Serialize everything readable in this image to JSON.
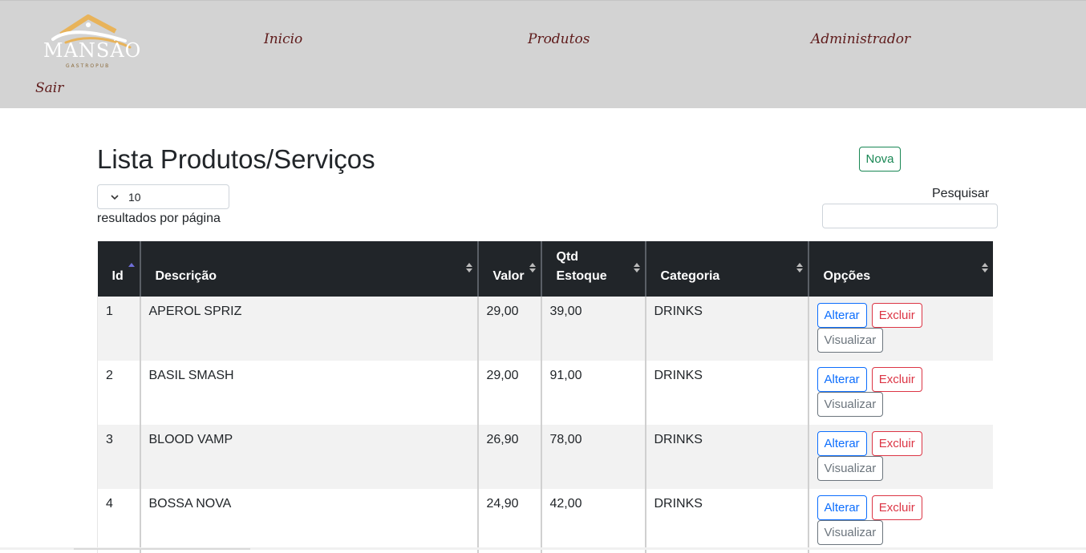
{
  "brand": {
    "logo_text": "MANSÃO",
    "logo_subtext": "GASTROPUB"
  },
  "nav": {
    "inicio": "Inicio",
    "produtos": "Produtos",
    "administrador": "Administrador",
    "sair": "Sair"
  },
  "page": {
    "title": "Lista Produtos/Serviços",
    "new_button": "Nova",
    "per_page_value": "10",
    "per_page_label": "resultados por página",
    "search_label": "Pesquisar",
    "search_value": ""
  },
  "table": {
    "columns": [
      "Id",
      "Descrição",
      "Valor",
      "Qtd Estoque",
      "Categoria",
      "Opções"
    ],
    "sorted_column": "Id",
    "sort_direction": "ascending",
    "rows": [
      {
        "id": "1",
        "descricao": "APEROL SPRIZ",
        "valor": "29,00",
        "qtd": "39,00",
        "categoria": "DRINKS"
      },
      {
        "id": "2",
        "descricao": "BASIL SMASH",
        "valor": "29,00",
        "qtd": "91,00",
        "categoria": "DRINKS"
      },
      {
        "id": "3",
        "descricao": "BLOOD VAMP",
        "valor": "26,90",
        "qtd": "78,00",
        "categoria": "DRINKS"
      },
      {
        "id": "4",
        "descricao": "BOSSA NOVA",
        "valor": "24,90",
        "qtd": "42,00",
        "categoria": "DRINKS"
      }
    ],
    "actions": {
      "edit": "Alterar",
      "delete": "Excluir",
      "view": "Visualizar"
    }
  },
  "colors": {
    "header_bg": "#d3d3d3",
    "nav_text": "#5e1a1a",
    "table_head_bg": "#212529",
    "primary": "#0d6efd",
    "danger": "#dc3545",
    "success": "#198754",
    "secondary": "#6c757d",
    "logo_gold": "#e8b35a"
  }
}
